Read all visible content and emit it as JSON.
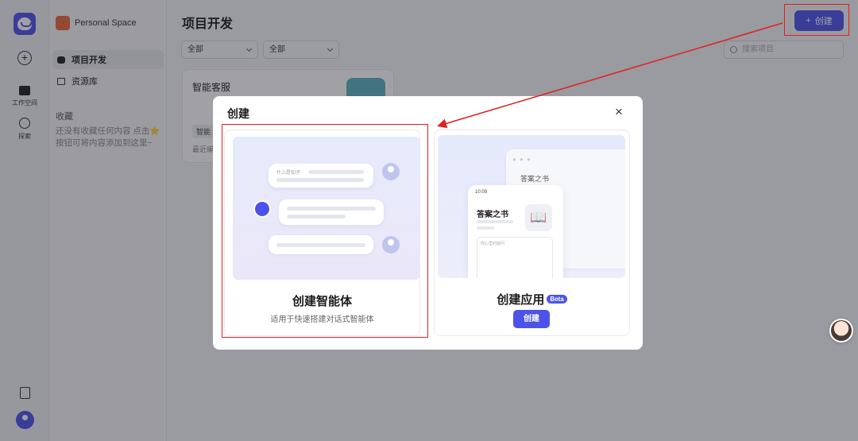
{
  "rail": {
    "workspace_label": "工作空间",
    "explore_label": "探索"
  },
  "side": {
    "space_name": "Personal Space",
    "nav": [
      {
        "label": "项目开发",
        "active": true
      },
      {
        "label": "资源库",
        "active": false
      }
    ],
    "favorites_title": "收藏",
    "favorites_empty": "还没有收藏任何内容 点击⭐按钮可将内容添加到这里~"
  },
  "main": {
    "title": "项目开发",
    "create_label": "创建",
    "filter1": "全部",
    "filter2": "全部",
    "search_placeholder": "搜索项目",
    "card": {
      "title": "智能客服",
      "tag": "智能",
      "footer": "最近编"
    }
  },
  "modal": {
    "title": "创建",
    "close": "×",
    "agent": {
      "name": "创建智能体",
      "desc": "适用于快速搭建对话式智能体",
      "illustration_hint": "什么是知子"
    },
    "app": {
      "name": "创建应用",
      "badge": "Beta",
      "button": "创建",
      "window_title": "答案之书",
      "phone_time": "10:09",
      "phone_title": "答案之书",
      "phone_input_hint": "你心里的疑问"
    }
  },
  "colors": {
    "accent": "#4d53e8",
    "annotation": "#e02020"
  }
}
